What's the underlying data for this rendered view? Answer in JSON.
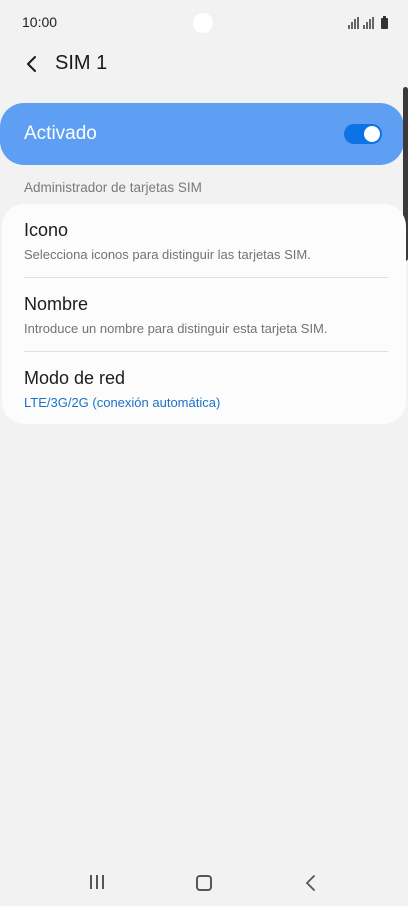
{
  "status_bar": {
    "time": "10:00"
  },
  "header": {
    "title": "SIM 1",
    "back_icon": "chevron-left-icon"
  },
  "toggle": {
    "label": "Activado",
    "state": "on",
    "accent_color": "#5e9ff3",
    "switch_color": "#0c73e6"
  },
  "section": {
    "header": "Administrador de tarjetas SIM"
  },
  "settings": [
    {
      "title": "Icono",
      "subtitle": "Selecciona iconos para distinguir las tarjetas SIM."
    },
    {
      "title": "Nombre",
      "subtitle": "Introduce un nombre para distinguir esta tarjeta SIM."
    },
    {
      "title": "Modo de red",
      "subtitle": "LTE/3G/2G (conexión automática)",
      "subtitle_color": "#1a73c9"
    }
  ],
  "nav_bar": {
    "recents_icon": "recents-icon",
    "home_icon": "home-icon",
    "back_icon": "back-icon"
  }
}
